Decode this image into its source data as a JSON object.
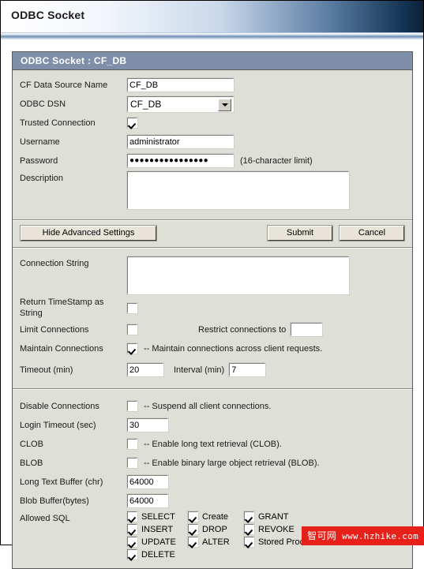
{
  "banner": {
    "title": "ODBC Socket"
  },
  "panel": {
    "title": "ODBC Socket : CF_DB"
  },
  "basic": {
    "cf_data_source_name": {
      "label": "CF Data Source Name",
      "value": "CF_DB"
    },
    "odbc_dsn": {
      "label": "ODBC DSN",
      "value": "CF_DB",
      "options": [
        "CF_DB"
      ]
    },
    "trusted_connection": {
      "label": "Trusted Connection",
      "checked": true
    },
    "username": {
      "label": "Username",
      "value": "administrator"
    },
    "password": {
      "label": "Password",
      "value": "●●●●●●●●●●●●●●●●",
      "hint": "(16-character limit)"
    },
    "description": {
      "label": "Description",
      "value": ""
    }
  },
  "buttons": {
    "hide_advanced": "Hide Advanced Settings",
    "submit": "Submit",
    "cancel": "Cancel"
  },
  "advanced": {
    "connection_string": {
      "label": "Connection String",
      "value": ""
    },
    "return_timestamp_as_string": {
      "label": "Return TimeStamp as String",
      "checked": false
    },
    "limit_connections": {
      "label": "Limit Connections",
      "checked": false
    },
    "restrict_connections_to": {
      "label": "Restrict connections to",
      "value": ""
    },
    "maintain_connections": {
      "label": "Maintain Connections",
      "checked": true,
      "note": "-- Maintain connections across client requests."
    },
    "timeout_min": {
      "label": "Timeout (min)",
      "value": "20"
    },
    "interval_min": {
      "label": "Interval (min)",
      "value": "7"
    }
  },
  "extended": {
    "disable_connections": {
      "label": "Disable Connections",
      "checked": false,
      "note": "-- Suspend all client connections."
    },
    "login_timeout_sec": {
      "label": "Login Timeout (sec)",
      "value": "30"
    },
    "clob": {
      "label": "CLOB",
      "checked": false,
      "note": "-- Enable long text retrieval (CLOB)."
    },
    "blob": {
      "label": "BLOB",
      "checked": false,
      "note": "-- Enable binary large object retrieval (BLOB)."
    },
    "long_text_buffer": {
      "label": "Long Text Buffer (chr)",
      "value": "64000"
    },
    "blob_buffer": {
      "label": "Blob Buffer(bytes)",
      "value": "64000"
    },
    "allowed_sql": {
      "label": "Allowed SQL",
      "rows": [
        [
          {
            "name": "SELECT",
            "checked": true
          },
          {
            "name": "Create",
            "checked": true
          },
          {
            "name": "GRANT",
            "checked": true
          }
        ],
        [
          {
            "name": "INSERT",
            "checked": true
          },
          {
            "name": "DROP",
            "checked": true
          },
          {
            "name": "REVOKE",
            "checked": true
          }
        ],
        [
          {
            "name": "UPDATE",
            "checked": true
          },
          {
            "name": "ALTER",
            "checked": true
          },
          {
            "name": "Stored Procedures",
            "checked": true
          }
        ],
        [
          {
            "name": "DELETE",
            "checked": true
          }
        ]
      ]
    }
  },
  "watermark": {
    "brand": "智可网",
    "url": "www.hzhike.com"
  },
  "colors": {
    "title_bar": "#7f8fa9",
    "panel_bg": "#dedfd6",
    "watermark_bg": "#e8201a"
  }
}
